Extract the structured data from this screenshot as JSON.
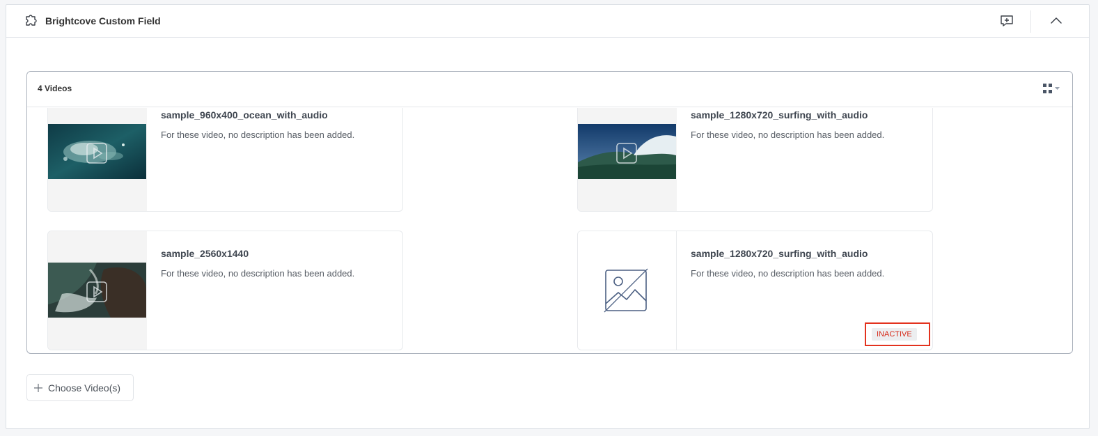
{
  "panel": {
    "title": "Brightcove Custom Field",
    "icons": {
      "field": "puzzle-icon",
      "comment": "comment-add-icon",
      "collapse": "chevron-up-icon"
    }
  },
  "videos": {
    "count_label": "4 Videos",
    "view_icon": "grid-view-icon",
    "items": [
      {
        "title": "sample_960x400_ocean_with_audio",
        "description": "For these video, no description has been added.",
        "thumbnail": "ocean"
      },
      {
        "title": "sample_1280x720_surfing_with_audio",
        "description": "For these video, no description has been added.",
        "thumbnail": "surfing"
      },
      {
        "title": "sample_2560x1440",
        "description": "For these video, no description has been added.",
        "thumbnail": "coast"
      },
      {
        "title": "sample_1280x720_surfing_with_audio",
        "description": "For these video, no description has been added.",
        "thumbnail": "none",
        "status": "INACTIVE"
      }
    ]
  },
  "actions": {
    "choose_label": "Choose Video(s)"
  },
  "colors": {
    "inactive_text": "#d62b1a",
    "highlight_border": "#e3321e",
    "border": "#a9b0bb"
  }
}
